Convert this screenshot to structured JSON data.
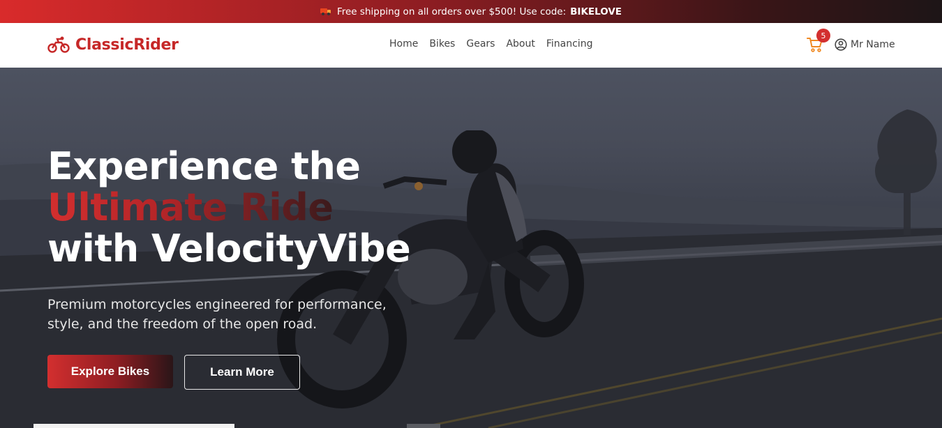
{
  "promo": {
    "icon": "truck-icon",
    "text": "Free shipping on all orders over $500! Use code:",
    "code": "BIKELOVE"
  },
  "header": {
    "logo": {
      "icon": "motorcycle-icon",
      "text": "ClassicRider",
      "color": "#c62828"
    },
    "nav": [
      "Home",
      "Bikes",
      "Gears",
      "About",
      "Financing"
    ],
    "cart": {
      "icon": "cart-icon",
      "count": "5",
      "color": "#f08a24"
    },
    "user": {
      "icon": "user-circle-icon",
      "name": "Mr Name"
    }
  },
  "hero": {
    "title_line1": "Experience the",
    "title_accent": "Ultimate Ride",
    "title_line3": "with VelocityVibe",
    "subtitle": "Premium motorcycles engineered for performance, style, and the freedom of the open road.",
    "primary_button": "Explore Bikes",
    "secondary_button": "Learn More",
    "accent_color": "#d32f2f"
  }
}
